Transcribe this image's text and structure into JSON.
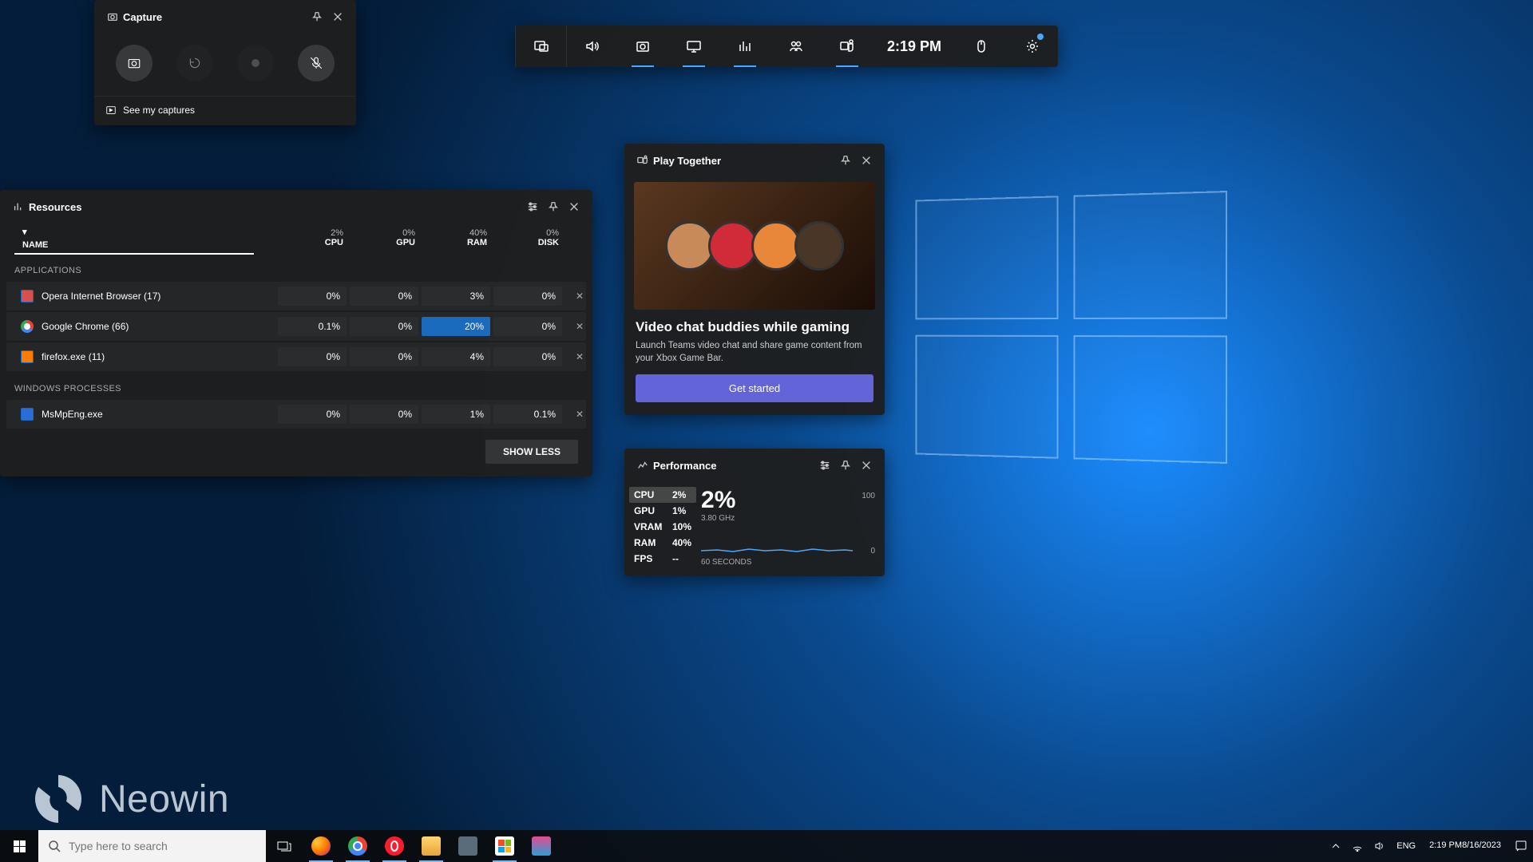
{
  "capture": {
    "title": "Capture",
    "see_link": "See my captures"
  },
  "topbar": {
    "clock": "2:19 PM"
  },
  "resources": {
    "title": "Resources",
    "name_header": "NAME",
    "cols": [
      {
        "pct": "2%",
        "label": "CPU"
      },
      {
        "pct": "0%",
        "label": "GPU"
      },
      {
        "pct": "40%",
        "label": "RAM"
      },
      {
        "pct": "0%",
        "label": "DISK"
      }
    ],
    "apps_header": "APPLICATIONS",
    "apps": [
      {
        "name": "Opera Internet Browser (17)",
        "cpu": "0%",
        "gpu": "0%",
        "ram": "3%",
        "disk": "0%",
        "color": "#d94f4f"
      },
      {
        "name": "Google Chrome (66)",
        "cpu": "0.1%",
        "gpu": "0%",
        "ram": "20%",
        "ram_hot": true,
        "disk": "0%",
        "color": "#ffffff",
        "chrome": true
      },
      {
        "name": "firefox.exe (11)",
        "cpu": "0%",
        "gpu": "0%",
        "ram": "4%",
        "disk": "0%",
        "color": "#ff7b00"
      }
    ],
    "win_header": "WINDOWS PROCESSES",
    "wins": [
      {
        "name": "MsMpEng.exe",
        "cpu": "0%",
        "gpu": "0%",
        "ram": "1%",
        "disk": "0.1%",
        "color": "#2b6dd6"
      }
    ],
    "show_less": "SHOW LESS"
  },
  "play": {
    "title": "Play Together",
    "heading": "Video chat buddies while gaming",
    "desc": "Launch Teams video chat and share game content from your Xbox Game Bar.",
    "cta": "Get started",
    "avatars": [
      "#c98a5a",
      "#d12b3a",
      "#e8873a",
      "#4a3626"
    ]
  },
  "perf": {
    "title": "Performance",
    "stats": [
      {
        "k": "CPU",
        "v": "2%",
        "sel": true
      },
      {
        "k": "GPU",
        "v": "1%"
      },
      {
        "k": "VRAM",
        "v": "10%"
      },
      {
        "k": "RAM",
        "v": "40%"
      },
      {
        "k": "FPS",
        "v": "--"
      }
    ],
    "big": "2%",
    "sub": "3.80 GHz",
    "axis_top": "100",
    "axis_bot": "0",
    "axis_x": "60 SECONDS"
  },
  "watermark": "Neowin",
  "taskbar": {
    "search_placeholder": "Type here to search",
    "lang": "ENG",
    "time": "2:19 PM",
    "date": "8/16/2023"
  }
}
